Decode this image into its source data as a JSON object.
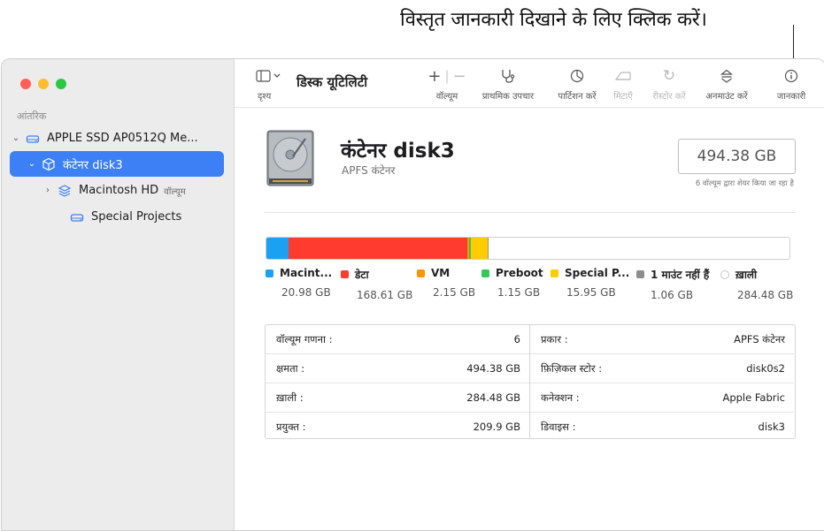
{
  "callout": "विस्तृत जानकारी दिखाने के लिए क्लिक करें।",
  "sidebar": {
    "section_label": "आंतरिक",
    "items": [
      {
        "label": "APPLE SSD AP0512Q Me..."
      },
      {
        "label": "कंटेनर disk3"
      },
      {
        "label": "Macintosh HD",
        "tag": "वॉल्यूम"
      },
      {
        "label": "Special Projects"
      }
    ]
  },
  "toolbar": {
    "view_label": "दृश्य",
    "title": "डिस्क यूटिलिटी",
    "volume_label": "वॉल्यूम",
    "first_aid_label": "प्राथमिक उपचार",
    "partition_label": "पार्टिशन करें",
    "erase_label": "मिटाएँ",
    "restore_label": "रीस्टोर करें",
    "unmount_label": "अनमाउंट करें",
    "info_label": "जानकारी"
  },
  "header": {
    "title": "कंटेनर disk3",
    "subtitle": "APFS कंटेनर",
    "size": "494.38 GB",
    "size_note": "6 वॉल्यूम द्वारा शेयर किया जा रहा है"
  },
  "usage": {
    "segments": [
      {
        "name": "Macint...",
        "value": "20.98 GB",
        "gb": 20.98,
        "color": "#1ba1f2"
      },
      {
        "name": "डेटा",
        "value": "168.61 GB",
        "gb": 168.61,
        "color": "#ff3b30"
      },
      {
        "name": "VM",
        "value": "2.15 GB",
        "gb": 2.15,
        "color": "#ff9500"
      },
      {
        "name": "Preboot",
        "value": "1.15 GB",
        "gb": 1.15,
        "color": "#34c759"
      },
      {
        "name": "Special P...",
        "value": "15.95 GB",
        "gb": 15.95,
        "color": "#ffcc00"
      },
      {
        "name": "1 माउंट नहीं हैं",
        "value": "1.06 GB",
        "gb": 1.06,
        "color": "#8e8e8e"
      },
      {
        "name": "ख़ाली",
        "value": "284.48 GB",
        "gb": 284.48,
        "color": "#ffffff"
      }
    ]
  },
  "info": {
    "left": [
      {
        "label": "वॉल्यूम गणना :",
        "value": "6"
      },
      {
        "label": "क्षमता :",
        "value": "494.38 GB"
      },
      {
        "label": "ख़ाली :",
        "value": "284.48 GB"
      },
      {
        "label": "प्रयुक्त :",
        "value": "209.9 GB"
      }
    ],
    "right": [
      {
        "label": "प्रकार :",
        "value": "APFS कंटेनर"
      },
      {
        "label": "फ़िज़िकल स्टोर :",
        "value": "disk0s2"
      },
      {
        "label": "कनेक्शन :",
        "value": "Apple Fabric"
      },
      {
        "label": "डिवाइस :",
        "value": "disk3"
      }
    ]
  },
  "colors": {
    "accent": "#3d7ff5",
    "sidebar_bg": "#ececec"
  }
}
